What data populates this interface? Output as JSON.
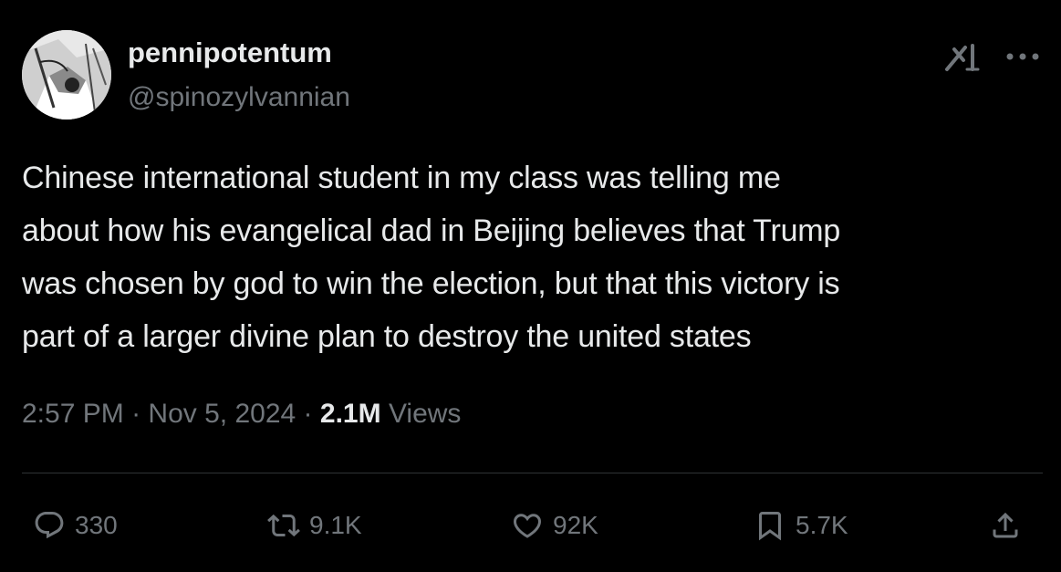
{
  "user": {
    "display_name": "pennipotentum",
    "handle": "@spinozylvannian"
  },
  "tweet": {
    "lines": [
      "Chinese international student in my class was telling me",
      "about how his evangelical dad in Beijing believes that Trump",
      "was chosen by god to win the election, but that this victory is",
      "part of a larger divine plan to destroy the united states"
    ],
    "time": "2:57 PM",
    "separator": "·",
    "date": "Nov 5, 2024",
    "views_count": "2.1M",
    "views_label": "Views"
  },
  "actions": {
    "replies": "330",
    "retweets": "9.1K",
    "likes": "92K",
    "bookmarks": "5.7K"
  },
  "icons": {
    "avatar": "avatar-image",
    "grok": "grok-icon",
    "more": "more-icon",
    "reply": "reply-icon",
    "retweet": "retweet-icon",
    "like": "heart-icon",
    "bookmark": "bookmark-icon",
    "share": "share-icon"
  },
  "colors": {
    "background": "#000000",
    "primary_text": "#e7e9ea",
    "secondary_text": "#71767b",
    "divider": "#2f3336"
  }
}
